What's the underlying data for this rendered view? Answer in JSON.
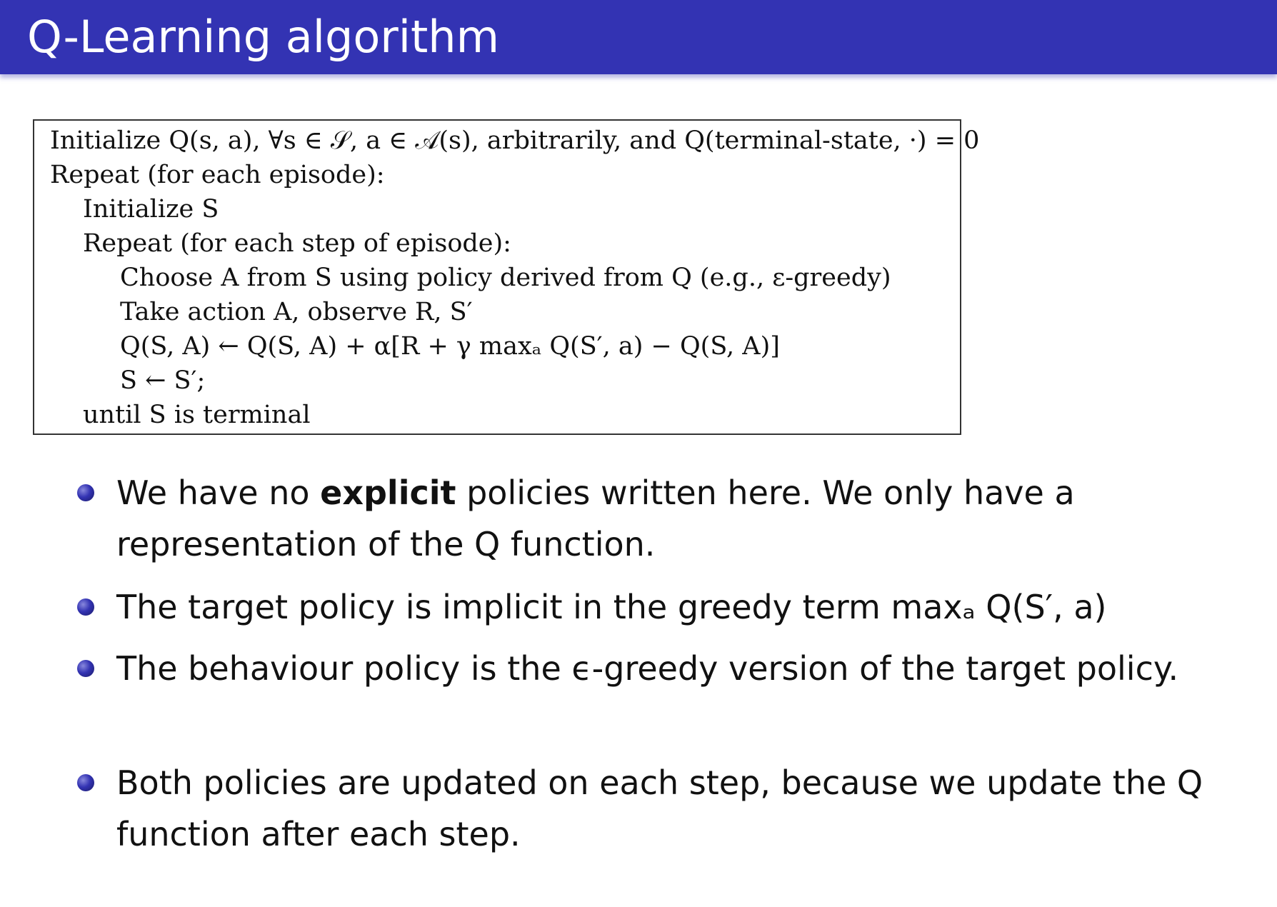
{
  "header": {
    "title": "Q-Learning algorithm"
  },
  "algorithm": {
    "lines": [
      "Initialize Q(s, a), ∀s ∈ 𝒮, a ∈ 𝒜(s), arbitrarily, and Q(terminal-state, ·) = 0",
      "Repeat (for each episode):",
      "Initialize S",
      "Repeat (for each step of episode):",
      "Choose A from S using policy derived from Q (e.g., ε-greedy)",
      "Take action A, observe R, S′",
      "Q(S, A) ← Q(S, A) + α[R + γ maxₐ Q(S′, a) − Q(S, A)]",
      "S ← S′;",
      "until S is terminal"
    ]
  },
  "bullets": [
    {
      "pre": "We have no ",
      "bold": "explicit",
      "post": " policies written here. We only have a representation of the Q function."
    },
    {
      "text": "The target policy is implicit in the greedy term maxₐ Q(S′, a)"
    },
    {
      "text": "The behaviour policy is the ϵ-greedy version of the target policy."
    },
    {
      "text": "Both policies are updated on each step, because we update the Q function after each step."
    }
  ]
}
